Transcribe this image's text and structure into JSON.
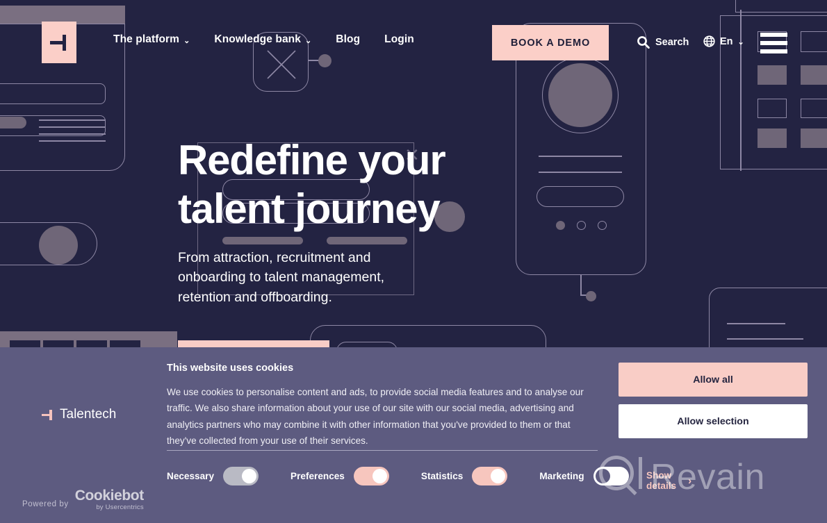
{
  "colors": {
    "page_bg": "#232342",
    "accent_pink": "#fbcfc8",
    "banner_bg": "#5d5b80",
    "wireframe_stroke": "#8e88a5",
    "mauve_fill": "#6f6678"
  },
  "header": {
    "logo_name": "talentech-logo",
    "nav": [
      {
        "label": "The platform",
        "has_dropdown": true,
        "chevron": "⌄"
      },
      {
        "label": "Knowledge bank",
        "has_dropdown": true,
        "chevron": "⌄"
      },
      {
        "label": "Blog",
        "has_dropdown": false,
        "chevron": ""
      },
      {
        "label": "Login",
        "has_dropdown": false,
        "chevron": ""
      }
    ],
    "book_demo_label": "BOOK A DEMO",
    "search_label": "Search",
    "search_icon": "search-icon",
    "language_label": "En",
    "language_chevron": "⌄",
    "globe_icon": "globe-icon",
    "menu_icon": "hamburger-menu-icon"
  },
  "hero": {
    "title_line1": "Redefine your",
    "title_line2": "talent journey",
    "subtitle": "From attraction, recruitment and onboarding to talent management, retention and offboarding."
  },
  "watermark": {
    "text": "Revain",
    "logo_name": "revain-logo"
  },
  "cookie_banner": {
    "brand_label": "Talentech",
    "title": "This website uses cookies",
    "body": "We use cookies to personalise content and ads, to provide social media features and to analyse our traffic. We also share information about your use of our site with our social media, advertising and analytics partners who may combine it with other information that you've provided to them or that they've collected from your use of their services.",
    "toggles": [
      {
        "label": "Necessary",
        "state": "on",
        "style": "gray"
      },
      {
        "label": "Preferences",
        "state": "on",
        "style": "pink"
      },
      {
        "label": "Statistics",
        "state": "on",
        "style": "pink"
      },
      {
        "label": "Marketing",
        "state": "off",
        "style": "white"
      }
    ],
    "show_details_label": "Show details",
    "show_details_chevron": "›",
    "allow_all_label": "Allow all",
    "allow_selection_label": "Allow selection",
    "powered_by_label": "Powered by",
    "provider_name": "Cookiebot",
    "provider_sub": "by Usercentrics"
  }
}
